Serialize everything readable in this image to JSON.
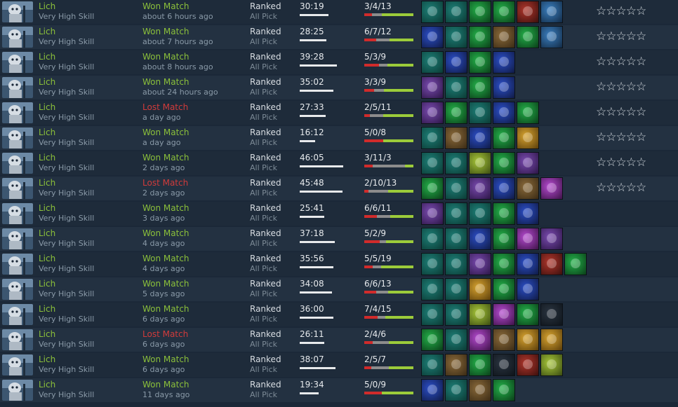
{
  "colors": {
    "win": "#8bc03a",
    "loss": "#d13b3b",
    "kills": "#d12b2b",
    "deaths": "#8c8c8c",
    "assists": "#9ccc3a"
  },
  "item_palette": {
    "teal": [
      "#1d7f77",
      "#0b3a34"
    ],
    "green": [
      "#24b14a",
      "#0a3d18"
    ],
    "purple": [
      "#7a4bb0",
      "#2b1545"
    ],
    "blue": [
      "#2b4ec7",
      "#0f1a44"
    ],
    "brown": [
      "#8a6a3a",
      "#3a2a14"
    ],
    "gold": [
      "#d8a430",
      "#5a3d0a"
    ],
    "red": [
      "#b0362c",
      "#3b0f0c"
    ],
    "lime": [
      "#a8c83a",
      "#3a4a10"
    ],
    "orb": [
      "#3a7fc0",
      "#122a44"
    ],
    "dark": [
      "#2a3440",
      "#0e141a"
    ],
    "magenta": [
      "#b54ad0",
      "#3d1247"
    ]
  },
  "matches": [
    {
      "hero": "Lich",
      "skill": "Very High Skill",
      "result": "Won Match",
      "outcome": "win",
      "ago": "about 6 hours ago",
      "mode": "Ranked",
      "pick": "All Pick",
      "duration": "30:19",
      "duration_fraction": 0.66,
      "kda": "3/4/13",
      "kills": 3,
      "deaths": 4,
      "assists": 13,
      "items": [
        "teal-item-icon",
        "teal-item-icon",
        "green-item-icon",
        "green-item-icon",
        "red-item-icon",
        "orb-item-icon"
      ],
      "stars": "☆☆☆☆☆"
    },
    {
      "hero": "Lich",
      "skill": "Very High Skill",
      "result": "Won Match",
      "outcome": "win",
      "ago": "about 7 hours ago",
      "mode": "Ranked",
      "pick": "All Pick",
      "duration": "28:25",
      "duration_fraction": 0.62,
      "kda": "6/7/12",
      "kills": 6,
      "deaths": 7,
      "assists": 12,
      "items": [
        "blue-item-icon",
        "teal-item-icon",
        "green-item-icon",
        "brown-item-icon",
        "green-item-icon",
        "orb-item-icon"
      ],
      "stars": "☆☆☆☆☆"
    },
    {
      "hero": "Lich",
      "skill": "Very High Skill",
      "result": "Won Match",
      "outcome": "win",
      "ago": "about 8 hours ago",
      "mode": "Ranked",
      "pick": "All Pick",
      "duration": "39:28",
      "duration_fraction": 0.86,
      "kda": "5/3/9",
      "kills": 5,
      "deaths": 3,
      "assists": 9,
      "items": [
        "teal-item-icon",
        "blue-item-icon",
        "green-item-icon",
        "blue-item-icon"
      ],
      "stars": "☆☆☆☆☆"
    },
    {
      "hero": "Lich",
      "skill": "Very High Skill",
      "result": "Won Match",
      "outcome": "win",
      "ago": "about 24 hours ago",
      "mode": "Ranked",
      "pick": "All Pick",
      "duration": "35:02",
      "duration_fraction": 0.77,
      "kda": "3/3/9",
      "kills": 3,
      "deaths": 3,
      "assists": 9,
      "items": [
        "purple-item-icon",
        "teal-item-icon",
        "green-item-icon",
        "blue-item-icon"
      ],
      "stars": "☆☆☆☆☆"
    },
    {
      "hero": "Lich",
      "skill": "Very High Skill",
      "result": "Lost Match",
      "outcome": "loss",
      "ago": "a day ago",
      "mode": "Ranked",
      "pick": "All Pick",
      "duration": "27:33",
      "duration_fraction": 0.6,
      "kda": "2/5/11",
      "kills": 2,
      "deaths": 5,
      "assists": 11,
      "items": [
        "purple-item-icon",
        "green-item-icon",
        "teal-item-icon",
        "blue-item-icon",
        "green-item-icon"
      ],
      "stars": "☆☆☆☆☆"
    },
    {
      "hero": "Lich",
      "skill": "Very High Skill",
      "result": "Won Match",
      "outcome": "win",
      "ago": "a day ago",
      "mode": "Ranked",
      "pick": "All Pick",
      "duration": "16:12",
      "duration_fraction": 0.35,
      "kda": "5/0/8",
      "kills": 5,
      "deaths": 0,
      "assists": 8,
      "items": [
        "teal-item-icon",
        "brown-item-icon",
        "blue-item-icon",
        "green-item-icon",
        "gold-item-icon"
      ],
      "stars": "☆☆☆☆☆"
    },
    {
      "hero": "Lich",
      "skill": "Very High Skill",
      "result": "Won Match",
      "outcome": "win",
      "ago": "2 days ago",
      "mode": "Ranked",
      "pick": "All Pick",
      "duration": "46:05",
      "duration_fraction": 1.0,
      "kda": "3/11/3",
      "kills": 3,
      "deaths": 11,
      "assists": 3,
      "items": [
        "teal-item-icon",
        "teal-item-icon",
        "lime-item-icon",
        "green-item-icon",
        "purple-item-icon"
      ],
      "stars": "☆☆☆☆☆"
    },
    {
      "hero": "Lich",
      "skill": "Very High Skill",
      "result": "Lost Match",
      "outcome": "loss",
      "ago": "2 days ago",
      "mode": "Ranked",
      "pick": "All Pick",
      "duration": "45:48",
      "duration_fraction": 0.99,
      "kda": "2/10/13",
      "kills": 2,
      "deaths": 10,
      "assists": 13,
      "items": [
        "green-item-icon",
        "teal-item-icon",
        "purple-item-icon",
        "blue-item-icon",
        "brown-item-icon",
        "magenta-item-icon"
      ],
      "stars": "☆☆☆☆☆"
    },
    {
      "hero": "Lich",
      "skill": "Very High Skill",
      "result": "Won Match",
      "outcome": "win",
      "ago": "3 days ago",
      "mode": "Ranked",
      "pick": "All Pick",
      "duration": "25:41",
      "duration_fraction": 0.56,
      "kda": "6/6/11",
      "kills": 6,
      "deaths": 6,
      "assists": 11,
      "items": [
        "purple-item-icon",
        "teal-item-icon",
        "teal-item-icon",
        "green-item-icon",
        "blue-item-icon"
      ],
      "stars": ""
    },
    {
      "hero": "Lich",
      "skill": "Very High Skill",
      "result": "Won Match",
      "outcome": "win",
      "ago": "4 days ago",
      "mode": "Ranked",
      "pick": "All Pick",
      "duration": "37:18",
      "duration_fraction": 0.81,
      "kda": "5/2/9",
      "kills": 5,
      "deaths": 2,
      "assists": 9,
      "items": [
        "teal-item-icon",
        "teal-item-icon",
        "blue-item-icon",
        "green-item-icon",
        "magenta-item-icon",
        "purple-item-icon"
      ],
      "stars": ""
    },
    {
      "hero": "Lich",
      "skill": "Very High Skill",
      "result": "Won Match",
      "outcome": "win",
      "ago": "4 days ago",
      "mode": "Ranked",
      "pick": "All Pick",
      "duration": "35:56",
      "duration_fraction": 0.78,
      "kda": "5/5/19",
      "kills": 5,
      "deaths": 5,
      "assists": 19,
      "items": [
        "teal-item-icon",
        "teal-item-icon",
        "purple-item-icon",
        "green-item-icon",
        "blue-item-icon",
        "red-item-icon",
        "green-item-icon"
      ],
      "stars": ""
    },
    {
      "hero": "Lich",
      "skill": "Very High Skill",
      "result": "Won Match",
      "outcome": "win",
      "ago": "5 days ago",
      "mode": "Ranked",
      "pick": "All Pick",
      "duration": "34:08",
      "duration_fraction": 0.74,
      "kda": "6/6/13",
      "kills": 6,
      "deaths": 6,
      "assists": 13,
      "items": [
        "teal-item-icon",
        "teal-item-icon",
        "gold-item-icon",
        "green-item-icon",
        "blue-item-icon"
      ],
      "stars": ""
    },
    {
      "hero": "Lich",
      "skill": "Very High Skill",
      "result": "Won Match",
      "outcome": "win",
      "ago": "6 days ago",
      "mode": "Ranked",
      "pick": "All Pick",
      "duration": "36:00",
      "duration_fraction": 0.78,
      "kda": "7/4/15",
      "kills": 7,
      "deaths": 4,
      "assists": 15,
      "items": [
        "teal-item-icon",
        "teal-item-icon",
        "lime-item-icon",
        "magenta-item-icon",
        "green-item-icon",
        "dark-item-icon"
      ],
      "stars": ""
    },
    {
      "hero": "Lich",
      "skill": "Very High Skill",
      "result": "Lost Match",
      "outcome": "loss",
      "ago": "6 days ago",
      "mode": "Ranked",
      "pick": "All Pick",
      "duration": "26:11",
      "duration_fraction": 0.57,
      "kda": "2/4/6",
      "kills": 2,
      "deaths": 4,
      "assists": 6,
      "items": [
        "green-item-icon",
        "teal-item-icon",
        "magenta-item-icon",
        "brown-item-icon",
        "gold-item-icon",
        "gold-item-icon"
      ],
      "stars": ""
    },
    {
      "hero": "Lich",
      "skill": "Very High Skill",
      "result": "Won Match",
      "outcome": "win",
      "ago": "6 days ago",
      "mode": "Ranked",
      "pick": "All Pick",
      "duration": "38:07",
      "duration_fraction": 0.83,
      "kda": "2/5/7",
      "kills": 2,
      "deaths": 5,
      "assists": 7,
      "items": [
        "teal-item-icon",
        "brown-item-icon",
        "green-item-icon",
        "dark-item-icon",
        "red-item-icon",
        "lime-item-icon"
      ],
      "stars": ""
    },
    {
      "hero": "Lich",
      "skill": "Very High Skill",
      "result": "Won Match",
      "outcome": "win",
      "ago": "11 days ago",
      "mode": "Ranked",
      "pick": "All Pick",
      "duration": "19:34",
      "duration_fraction": 0.43,
      "kda": "5/0/9",
      "kills": 5,
      "deaths": 0,
      "assists": 9,
      "items": [
        "blue-item-icon",
        "teal-item-icon",
        "brown-item-icon",
        "green-item-icon"
      ],
      "stars": ""
    }
  ]
}
